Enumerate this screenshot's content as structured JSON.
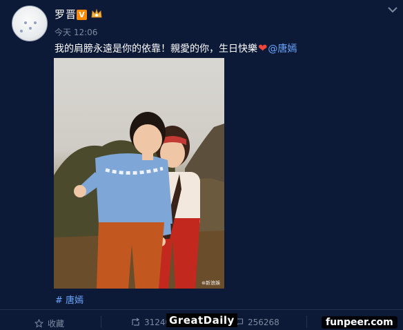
{
  "post": {
    "author": "罗晋",
    "verified_badge": "V",
    "time": "今天 12:06",
    "text_main": "我的肩膀永遠是你的依靠！親愛的你，生日快樂",
    "heart": "❤",
    "mention": "@唐嫣",
    "photo_watermark": "⊛新浪娛",
    "topic_tag": "# 唐嫣"
  },
  "actions": {
    "favorite_label": "收藏",
    "repost_count": "31240",
    "comment_count": "256268",
    "like_count": ""
  },
  "overlays": {
    "left_watermark": "GreatDaily",
    "right_watermark": "funpeer.com"
  },
  "icons": [
    "avatar",
    "crown-icon",
    "chevron-down-icon",
    "star-icon",
    "repost-icon",
    "comment-icon"
  ],
  "colors": {
    "background": "#0c1a38",
    "link": "#6aa7ff",
    "verified": "#ff8a00",
    "heart": "#f0463c"
  }
}
